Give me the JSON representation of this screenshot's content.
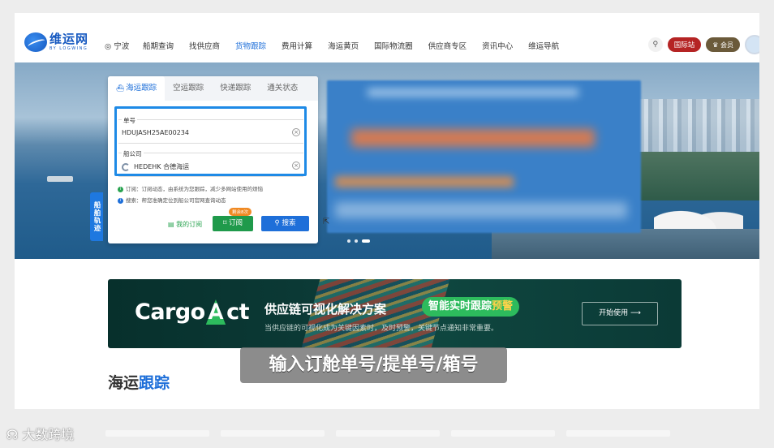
{
  "nav": {
    "logo_cn": "维运网",
    "logo_en": "BY LOGWING",
    "location": "◎ 宁波",
    "menu": [
      "船期查询",
      "找供应商",
      "货物跟踪",
      "费用计算",
      "海运黄页",
      "国际物流圈",
      "供应商专区",
      "资讯中心",
      "维运导航"
    ],
    "active_menu": "货物跟踪",
    "intl_label": "国际站",
    "vip_label": "会员"
  },
  "tracking": {
    "side_tab": "船舶轨迹",
    "tabs": [
      "海运跟踪",
      "空运跟踪",
      "快递跟踪",
      "通关状态"
    ],
    "active_tab": "海运跟踪",
    "bill_label": "单号",
    "bill_value": "HDUJASH25AE00234",
    "carrier_label": "船公司",
    "carrier_value": "HEDEHK 合德海运",
    "note_subscribe": "订阅：订阅动态，由系统为您跟踪，减少多网站使用的烦恼",
    "note_search": "搜索：帮您准确定位到船公司官网查询动态",
    "my_subscriptions": "我的订阅",
    "subscribe_button": "订阅",
    "subscribe_badge": "剩余8次",
    "search_button": "搜索"
  },
  "banner": {
    "brand": "CargoAct",
    "brand_pre": "Cargo",
    "brand_a": "A",
    "brand_post": "ct",
    "title": "供应链可视化解决方案",
    "pill_main": "智能实时跟踪",
    "pill_warn": "预警",
    "subtitle": "当供应链的可视化成为关键因素时，及时预警，关键节点通知非常重要。",
    "cta": "开始使用 ⟶"
  },
  "section": {
    "title_pre": "海运",
    "title_hl": "跟踪"
  },
  "caption": "输入订舱单号/提单号/箱号",
  "watermark": "大数跨境",
  "colors": {
    "primary": "#1e6fd9",
    "green": "#1f9a4b",
    "intl_red": "#b52424",
    "banner_bg": "#0c3b37"
  },
  "icons": [
    "search-icon",
    "location-icon",
    "ship-icon",
    "clear-icon",
    "bookmark-icon",
    "mouse-cursor-icon"
  ]
}
